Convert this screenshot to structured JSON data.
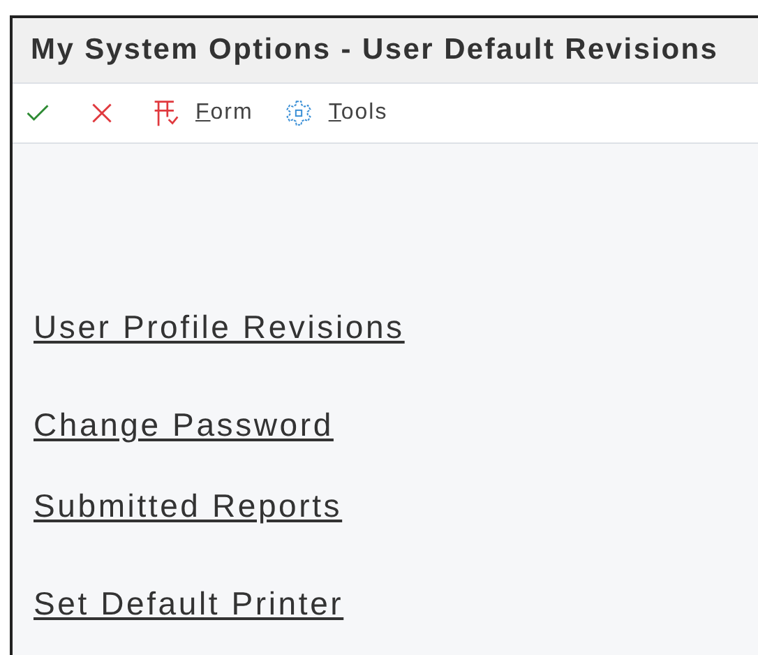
{
  "window": {
    "title": "My System Options - User Default Revisions"
  },
  "toolbar": [
    {
      "kind": "ok"
    },
    {
      "kind": "cancel"
    },
    {
      "kind": "form",
      "label": "Form",
      "underline_first": true
    },
    {
      "kind": "tools",
      "label": "Tools",
      "underline_first": true
    }
  ],
  "links": [
    {
      "label": "User Profile Revisions"
    },
    {
      "label": "Change Password"
    },
    {
      "label": "Submitted Reports"
    },
    {
      "label": "Set Default Printer"
    }
  ]
}
